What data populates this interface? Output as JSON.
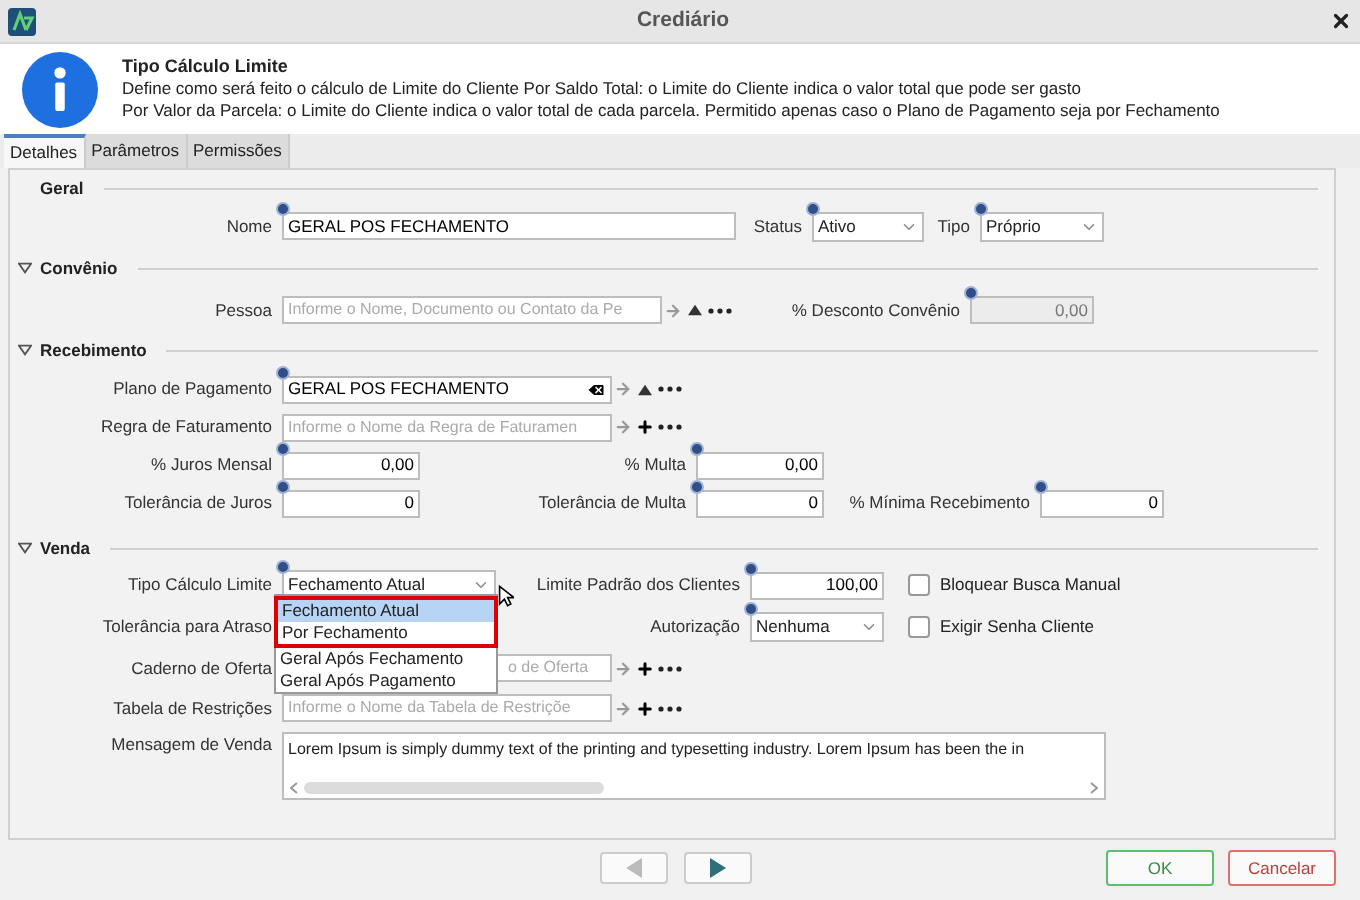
{
  "window": {
    "title": "Crediário"
  },
  "info": {
    "title": "Tipo Cálculo Limite",
    "lines": [
      "Define como será feito o cálculo de Limite do Cliente Por Saldo Total: o Limite do Cliente indica o valor total que pode ser gasto",
      "Por Valor da Parcela: o Limite do Cliente indica o valor total de cada parcela. Permitido apenas caso o Plano de Pagamento seja por Fechamento"
    ]
  },
  "tabs": [
    {
      "label": "Detalhes",
      "selected": true
    },
    {
      "label": "Parâmetros",
      "selected": false
    },
    {
      "label": "Permissões",
      "selected": false
    }
  ],
  "geral": {
    "title": "Geral",
    "nome": {
      "label": "Nome",
      "value": "GERAL POS FECHAMENTO",
      "required": true
    },
    "status": {
      "label": "Status",
      "value": "Ativo",
      "required": true
    },
    "tipo": {
      "label": "Tipo",
      "value": "Próprio",
      "required": true
    }
  },
  "convenio": {
    "title": "Convênio",
    "expanded": true,
    "pessoa": {
      "label": "Pessoa",
      "placeholder": "Informe o Nome, Documento ou Contato da Pe",
      "buttons": [
        {
          "kind": "arrow"
        },
        {
          "kind": "up"
        },
        {
          "kind": "more"
        }
      ]
    },
    "desconto": {
      "label": "% Desconto Convênio",
      "value": "0,00",
      "required": true,
      "disabled": true
    }
  },
  "recebimento": {
    "title": "Recebimento",
    "expanded": true,
    "plano": {
      "label": "Plano de Pagamento",
      "value": "GERAL POS FECHAMENTO",
      "required": true,
      "buttons": [
        {
          "kind": "clear"
        },
        {
          "kind": "arrow"
        },
        {
          "kind": "up"
        },
        {
          "kind": "more"
        }
      ]
    },
    "regra": {
      "label": "Regra de Faturamento",
      "placeholder": "Informe o Nome da Regra de Faturamen",
      "buttons": [
        {
          "kind": "arrow"
        },
        {
          "kind": "plus"
        },
        {
          "kind": "more"
        }
      ]
    },
    "juros": {
      "label": "% Juros Mensal",
      "value": "0,00",
      "required": true
    },
    "multa": {
      "label": "% Multa",
      "value": "0,00",
      "required": true
    },
    "tol_juros": {
      "label": "Tolerância de Juros",
      "value": "0",
      "required": true
    },
    "tol_multa": {
      "label": "Tolerância de Multa",
      "value": "0",
      "required": true
    },
    "minima": {
      "label": "% Mínima Recebimento",
      "value": "0",
      "required": true
    }
  },
  "venda": {
    "title": "Venda",
    "expanded": true,
    "tipo_calculo": {
      "label": "Tipo Cálculo Limite",
      "value": "Fechamento Atual",
      "required": true,
      "open": true,
      "options": [
        {
          "label": "Fechamento Atual",
          "selected": true,
          "highlighted": true
        },
        {
          "label": "Por Fechamento",
          "selected": false,
          "highlighted": true
        },
        {
          "label": "Geral Após Fechamento",
          "selected": false,
          "highlighted": false
        },
        {
          "label": "Geral Após Pagamento",
          "selected": false,
          "highlighted": false
        }
      ]
    },
    "limite": {
      "label": "Limite Padrão dos Clientes",
      "value": "100,00",
      "required": true
    },
    "bloquear": {
      "label": "Bloquear Busca Manual",
      "checked": false
    },
    "tolerancia_atraso": {
      "label": "Tolerância para Atraso"
    },
    "autorizacao": {
      "label": "Autorização",
      "value": "Nenhuma",
      "required": true
    },
    "exigir": {
      "label": "Exigir Senha Cliente",
      "checked": false
    },
    "caderno": {
      "label": "Caderno de Oferta",
      "placeholder": "o de Oferta",
      "buttons": [
        {
          "kind": "arrow"
        },
        {
          "kind": "plus"
        },
        {
          "kind": "more"
        }
      ]
    },
    "tabela": {
      "label": "Tabela de Restrições",
      "placeholder": "Informe o Nome da Tabela de Restriçõe",
      "buttons": [
        {
          "kind": "arrow"
        },
        {
          "kind": "plus"
        },
        {
          "kind": "more"
        }
      ]
    },
    "mensagem": {
      "label": "Mensagem de Venda",
      "value": "Lorem Ipsum is simply dummy text of the printing and typesetting industry. Lorem Ipsum has been the in"
    }
  },
  "footer": {
    "prev_disabled": true,
    "next_disabled": false,
    "ok": "OK",
    "cancel": "Cancelar"
  }
}
